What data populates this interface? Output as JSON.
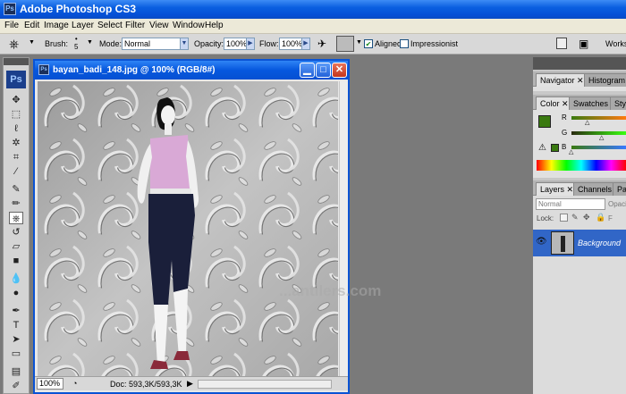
{
  "app": {
    "title": "Adobe Photoshop CS3",
    "icon": "Ps"
  },
  "menu": [
    "File",
    "Edit",
    "Image",
    "Layer",
    "Select",
    "Filter",
    "View",
    "Window",
    "Help"
  ],
  "options": {
    "brush_label": "Brush:",
    "brush_size": "5",
    "mode_label": "Mode:",
    "mode_value": "Normal",
    "opacity_label": "Opacity:",
    "opacity_value": "100%",
    "flow_label": "Flow:",
    "flow_value": "100%",
    "aligned_label": "Aligned",
    "aligned_checked": true,
    "impressionist_label": "Impressionist",
    "impressionist_checked": false,
    "workspace_label": "Worksp"
  },
  "toolbox": {
    "logo": "Ps"
  },
  "document": {
    "title": "bayan_badi_148.jpg @ 100% (RGB/8#)",
    "zoom": "100%",
    "info": "Doc: 593,3K/593,3K"
  },
  "watermark": "...antilers.com",
  "panels": {
    "nav_tabs": [
      "Navigator",
      "Histogram"
    ],
    "color_tabs": [
      "Color",
      "Swatches",
      "Styl"
    ],
    "color_labels": [
      "R",
      "G",
      "B"
    ],
    "layer_tabs": [
      "Layers",
      "Channels",
      "Pa"
    ],
    "blend_mode": "Normal",
    "opacity_label": "Opaci",
    "lock_label": "Lock:",
    "layer_name": "Background"
  },
  "colors": {
    "foreground": "#3a7a10",
    "accent": "#0a53d4"
  }
}
